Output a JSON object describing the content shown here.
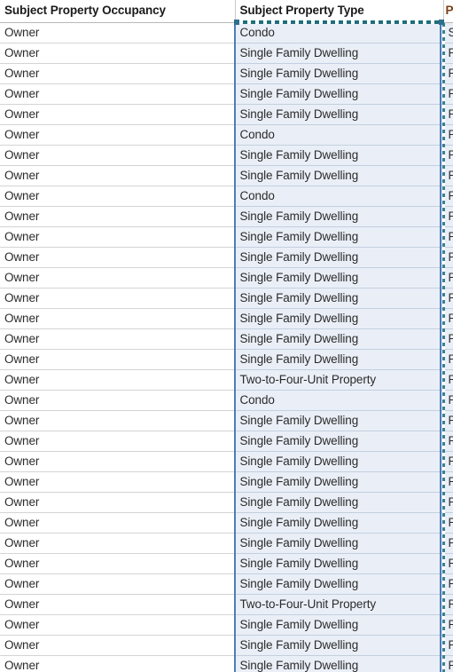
{
  "app": {
    "type": "spreadsheet",
    "selection_state": "copied-range-marching-ants"
  },
  "colors": {
    "selected_column_fill": "#eaeff7",
    "unselected_fill": "#ffffff",
    "selection_border": "#4a7ebb",
    "marching_ants": "#1f6f7a",
    "gridline": "#d4d4d4",
    "header_text": "#1a1a1a",
    "cell_text": "#2b2b2b",
    "clipped_column_text": "#7b3f16"
  },
  "table": {
    "columns": [
      {
        "key": "occupancy",
        "header": "Subject Property Occupancy",
        "selected": false
      },
      {
        "key": "type",
        "header": "Subject Property Type",
        "selected": true
      },
      {
        "key": "clipped",
        "header": "P",
        "selected": false,
        "clipped": true
      }
    ],
    "rows": [
      {
        "occupancy": "Owner",
        "type": "Condo",
        "clipped": "S"
      },
      {
        "occupancy": "Owner",
        "type": "Single Family Dwelling",
        "clipped": "P"
      },
      {
        "occupancy": "Owner",
        "type": "Single Family Dwelling",
        "clipped": "P"
      },
      {
        "occupancy": "Owner",
        "type": "Single Family Dwelling",
        "clipped": "R"
      },
      {
        "occupancy": "Owner",
        "type": "Single Family Dwelling",
        "clipped": "P"
      },
      {
        "occupancy": "Owner",
        "type": "Condo",
        "clipped": "R"
      },
      {
        "occupancy": "Owner",
        "type": "Single Family Dwelling",
        "clipped": "P"
      },
      {
        "occupancy": "Owner",
        "type": "Single Family Dwelling",
        "clipped": "P"
      },
      {
        "occupancy": "Owner",
        "type": "Condo",
        "clipped": "R"
      },
      {
        "occupancy": "Owner",
        "type": "Single Family Dwelling",
        "clipped": "P"
      },
      {
        "occupancy": "Owner",
        "type": "Single Family Dwelling",
        "clipped": "P"
      },
      {
        "occupancy": "Owner",
        "type": "Single Family Dwelling",
        "clipped": "R"
      },
      {
        "occupancy": "Owner",
        "type": "Single Family Dwelling",
        "clipped": "P"
      },
      {
        "occupancy": "Owner",
        "type": "Single Family Dwelling",
        "clipped": "P"
      },
      {
        "occupancy": "Owner",
        "type": "Single Family Dwelling",
        "clipped": "R"
      },
      {
        "occupancy": "Owner",
        "type": "Single Family Dwelling",
        "clipped": "P"
      },
      {
        "occupancy": "Owner",
        "type": "Single Family Dwelling",
        "clipped": "P"
      },
      {
        "occupancy": "Owner",
        "type": "Two-to-Four-Unit Property",
        "clipped": "R"
      },
      {
        "occupancy": "Owner",
        "type": "Condo",
        "clipped": "P"
      },
      {
        "occupancy": "Owner",
        "type": "Single Family Dwelling",
        "clipped": "P"
      },
      {
        "occupancy": "Owner",
        "type": "Single Family Dwelling",
        "clipped": "R"
      },
      {
        "occupancy": "Owner",
        "type": "Single Family Dwelling",
        "clipped": "P"
      },
      {
        "occupancy": "Owner",
        "type": "Single Family Dwelling",
        "clipped": "P"
      },
      {
        "occupancy": "Owner",
        "type": "Single Family Dwelling",
        "clipped": "R"
      },
      {
        "occupancy": "Owner",
        "type": "Single Family Dwelling",
        "clipped": "P"
      },
      {
        "occupancy": "Owner",
        "type": "Single Family Dwelling",
        "clipped": "P"
      },
      {
        "occupancy": "Owner",
        "type": "Single Family Dwelling",
        "clipped": "R"
      },
      {
        "occupancy": "Owner",
        "type": "Single Family Dwelling",
        "clipped": "P"
      },
      {
        "occupancy": "Owner",
        "type": "Two-to-Four-Unit Property",
        "clipped": "P"
      },
      {
        "occupancy": "Owner",
        "type": "Single Family Dwelling",
        "clipped": "R"
      },
      {
        "occupancy": "Owner",
        "type": "Single Family Dwelling",
        "clipped": "P"
      },
      {
        "occupancy": "Owner",
        "type": "Single Family Dwelling",
        "clipped": "P"
      }
    ]
  }
}
